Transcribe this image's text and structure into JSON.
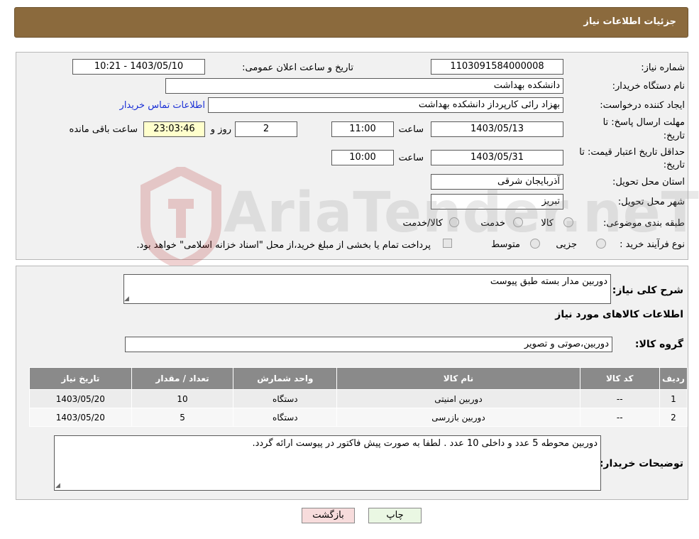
{
  "header": {
    "title": "جزئیات اطلاعات نیاز"
  },
  "need": {
    "number_label": "شماره نیاز:",
    "number_value": "1103091584000008",
    "announce_label": "تاریخ و ساعت اعلان عمومی:",
    "announce_value": "1403/05/10 - 10:21",
    "buyer_org_label": "نام دستگاه خریدار:",
    "buyer_org_value": "دانشکده بهداشت",
    "creator_label": "ایجاد کننده درخواست:",
    "creator_value": "بهزاد رائی کارپرداز دانشکده بهداشت",
    "contact_link": "اطلاعات تماس خریدار",
    "deadline_label_1": "مهلت ارسال پاسخ: تا",
    "deadline_label_2": "تاریخ:",
    "deadline_date": "1403/05/13",
    "hour_label": "ساعت",
    "deadline_time": "11:00",
    "days_value": "2",
    "days_label": "روز و",
    "remaining_value": "23:03:46",
    "remaining_label": "ساعت باقی مانده",
    "validity_label_1": "حداقل تاریخ اعتبار قیمت: تا",
    "validity_label_2": "تاریخ:",
    "validity_date": "1403/05/31",
    "validity_time": "10:00",
    "province_label": "استان محل تحویل:",
    "province_value": "آذربایجان شرقی",
    "city_label": "شهر محل تحویل:",
    "city_value": "تبریز",
    "category_label": "طبقه بندی موضوعی:",
    "category_options": [
      "کالا",
      "خدمت",
      "کالا/خدمت"
    ],
    "process_label": "نوع فرآیند خرید :",
    "process_options": [
      "جزیی",
      "متوسط"
    ],
    "payment_note": "پرداخت تمام یا بخشی از مبلغ خرید،از محل \"اسناد خزانه اسلامی\" خواهد بود."
  },
  "details": {
    "summary_label": "شرح کلی نیاز:",
    "summary_value": "دوربین مدار بسته طبق پیوست",
    "goods_title": "اطلاعات کالاهای مورد نیاز",
    "group_label": "گروه کالا:",
    "group_value": "دوربین،صوتی و تصویر",
    "table": {
      "headers": [
        "ردیف",
        "کد کالا",
        "نام کالا",
        "واحد شمارش",
        "تعداد / مقدار",
        "تاریخ نیاز"
      ],
      "rows": [
        [
          "1",
          "--",
          "دوربین امنیتی",
          "دستگاه",
          "10",
          "1403/05/20"
        ],
        [
          "2",
          "--",
          "دوربین بازرسی",
          "دستگاه",
          "5",
          "1403/05/20"
        ]
      ]
    },
    "buyer_notes_label": "توضیحات خریدار:",
    "buyer_notes_value": "دوربین محوطه 5 عدد و داخلی 10 عدد . لطفا به صورت پیش فاکتور در پیوست ارائه گردد."
  },
  "buttons": {
    "print": "چاپ",
    "back": "بازگشت"
  },
  "watermark": {
    "text": "AriaTender.neT"
  },
  "colors": {
    "header": "#8b6a3d",
    "table_header": "#8a8a8a",
    "print_btn": "#eaf7e3",
    "back_btn": "#f7dcdc",
    "link": "#1a2fd6"
  }
}
